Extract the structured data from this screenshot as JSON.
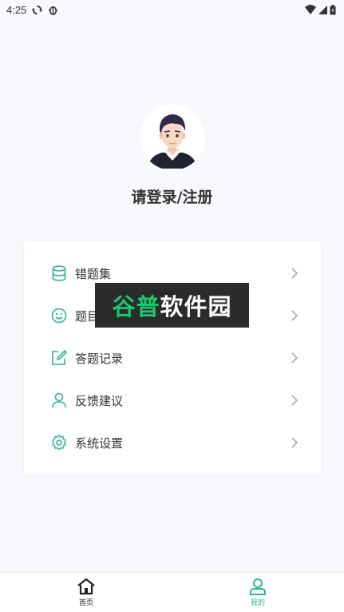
{
  "status_bar": {
    "time": "4:25"
  },
  "profile": {
    "login_label": "请登录/注册"
  },
  "menu": {
    "items": [
      {
        "label": "错题集",
        "icon": "database-icon"
      },
      {
        "label": "题目收藏",
        "icon": "smiley-icon"
      },
      {
        "label": "答题记录",
        "icon": "edit-note-icon"
      },
      {
        "label": "反馈建议",
        "icon": "person-icon"
      },
      {
        "label": "系统设置",
        "icon": "gear-icon"
      }
    ]
  },
  "watermark": {
    "text_a": "谷普",
    "text_b": "软件园"
  },
  "bottom_nav": {
    "home_label": "首页",
    "mine_label": "我的"
  },
  "colors": {
    "accent": "#2bb596",
    "text": "#333333",
    "background": "#f7f8fc"
  }
}
